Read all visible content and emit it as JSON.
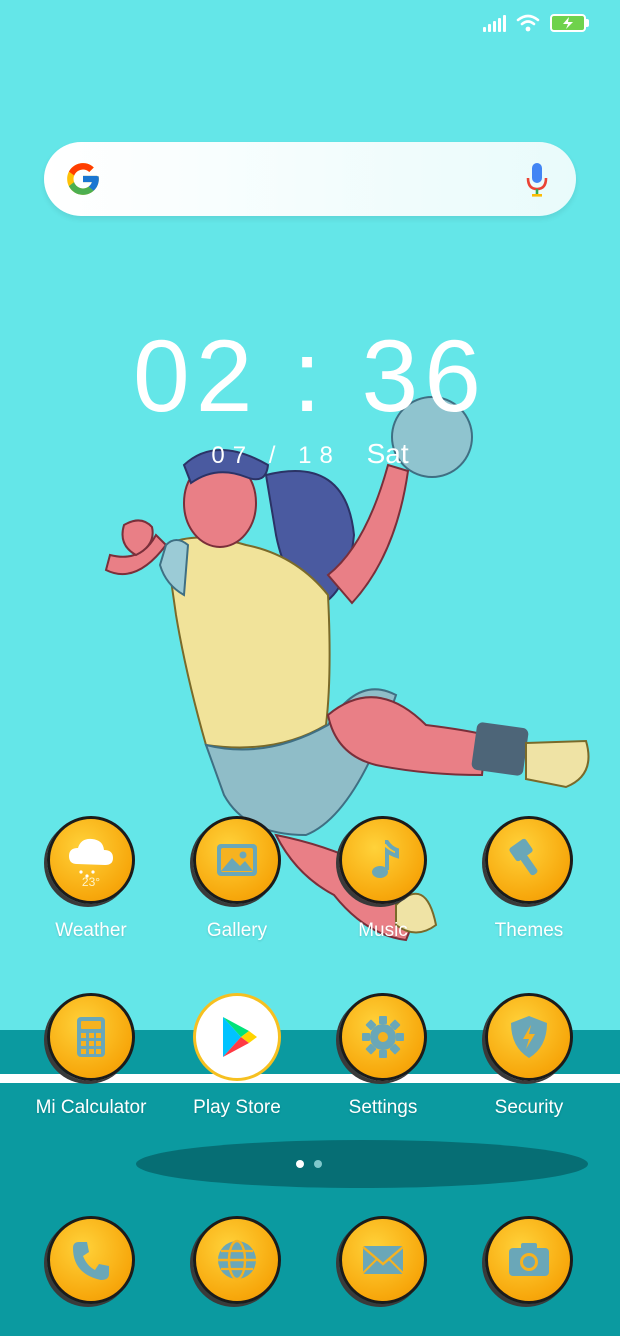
{
  "status_bar": {
    "signal_icon": "signal-icon",
    "wifi_icon": "wifi-icon",
    "battery_icon": "battery-charging-icon"
  },
  "search": {
    "logo": "google-logo",
    "mic_icon": "mic-icon"
  },
  "clock": {
    "time": "02 : 36",
    "date": "07 / 18",
    "day": "Sat"
  },
  "apps_row1": [
    {
      "label": "Weather",
      "icon": "weather-icon",
      "temp": "23°"
    },
    {
      "label": "Gallery",
      "icon": "gallery-icon"
    },
    {
      "label": "Music",
      "icon": "music-icon"
    },
    {
      "label": "Themes",
      "icon": "themes-icon"
    }
  ],
  "apps_row2": [
    {
      "label": "Mi Calculator",
      "icon": "calculator-icon"
    },
    {
      "label": "Play Store",
      "icon": "play-store-icon"
    },
    {
      "label": "Settings",
      "icon": "settings-icon"
    },
    {
      "label": "Security",
      "icon": "security-icon"
    }
  ],
  "dock": [
    {
      "icon": "phone-icon"
    },
    {
      "icon": "browser-icon"
    },
    {
      "icon": "messages-icon"
    },
    {
      "icon": "camera-icon"
    }
  ],
  "page_indicator": {
    "pages": 2,
    "active": 1
  },
  "colors": {
    "sky": "#64e6e8",
    "floor": "#0b9aa0",
    "icon_gold": "#f7a70b",
    "icon_glyph": "#6aa7b8"
  }
}
